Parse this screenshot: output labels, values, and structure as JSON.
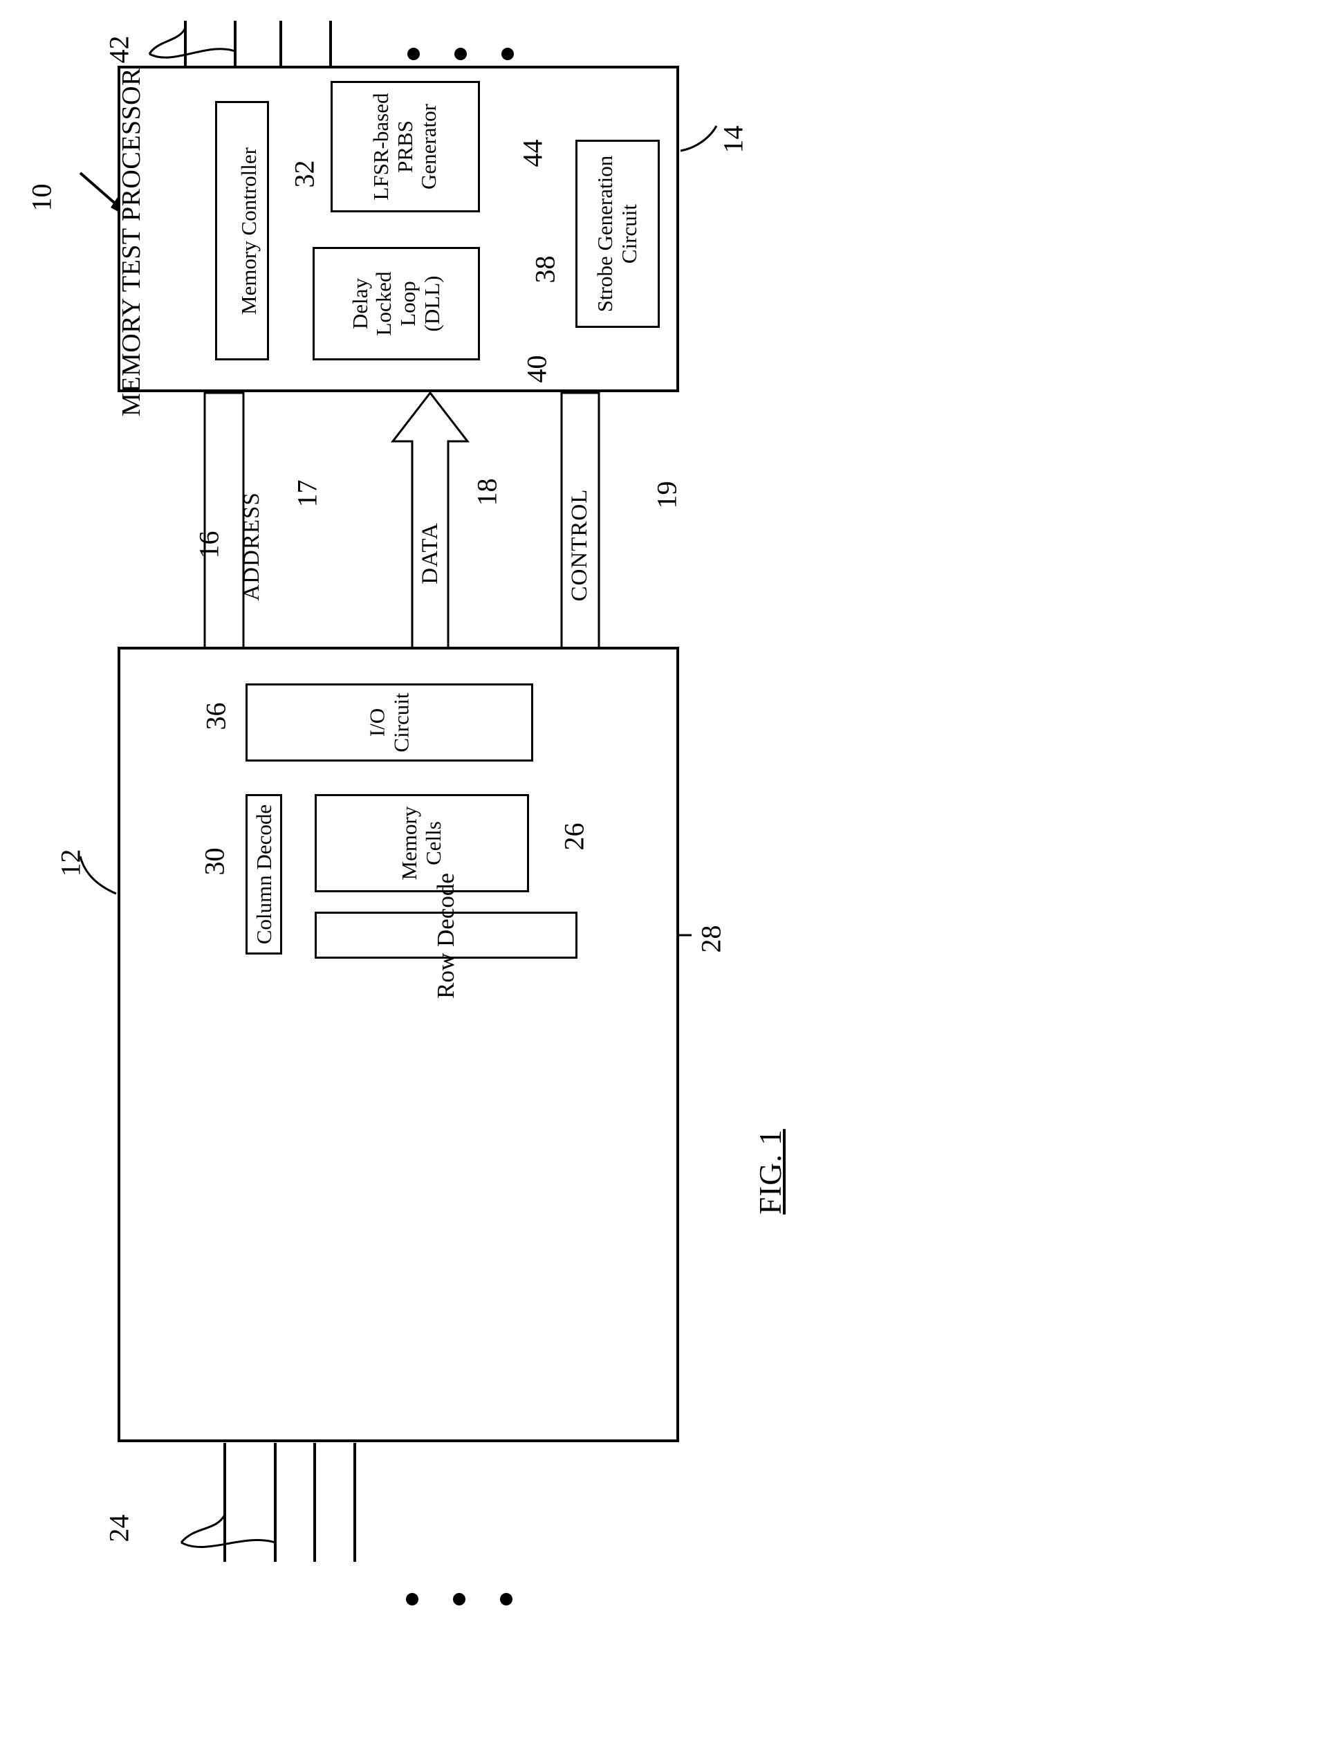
{
  "figure": {
    "caption": "FIG. 1",
    "system_ref": "10"
  },
  "memory_test_processor": {
    "title": "MEMORY TEST PROCESSOR",
    "ref": "14",
    "pins_ref": "42",
    "blocks": [
      {
        "label": "Memory Controller",
        "ref": "32"
      },
      {
        "label": "LFSR-based\nPRBS\nGenerator",
        "ref": "44"
      },
      {
        "label": "Delay\nLocked\nLoop\n(DLL)",
        "ref": "40"
      },
      {
        "label": "Strobe Generation\nCircuit",
        "ref": "38"
      }
    ]
  },
  "memory_device": {
    "ref": "12",
    "pins_ref": "24",
    "blocks": [
      {
        "label": "I/O\nCircuit",
        "ref": "36"
      },
      {
        "label": "Column Decode",
        "ref": "30"
      },
      {
        "label": "Memory\nCells",
        "ref": "26"
      },
      {
        "label": "Row Decode",
        "ref": "28"
      }
    ]
  },
  "bus": {
    "ref": "16",
    "signals": [
      {
        "label": "ADDRESS",
        "ref": "17",
        "direction": "down"
      },
      {
        "label": "DATA",
        "ref": "18",
        "direction": "bidirectional"
      },
      {
        "label": "CONTROL",
        "ref": "19",
        "direction": "down"
      }
    ]
  },
  "ellipsis": {
    "glyph": "•"
  }
}
